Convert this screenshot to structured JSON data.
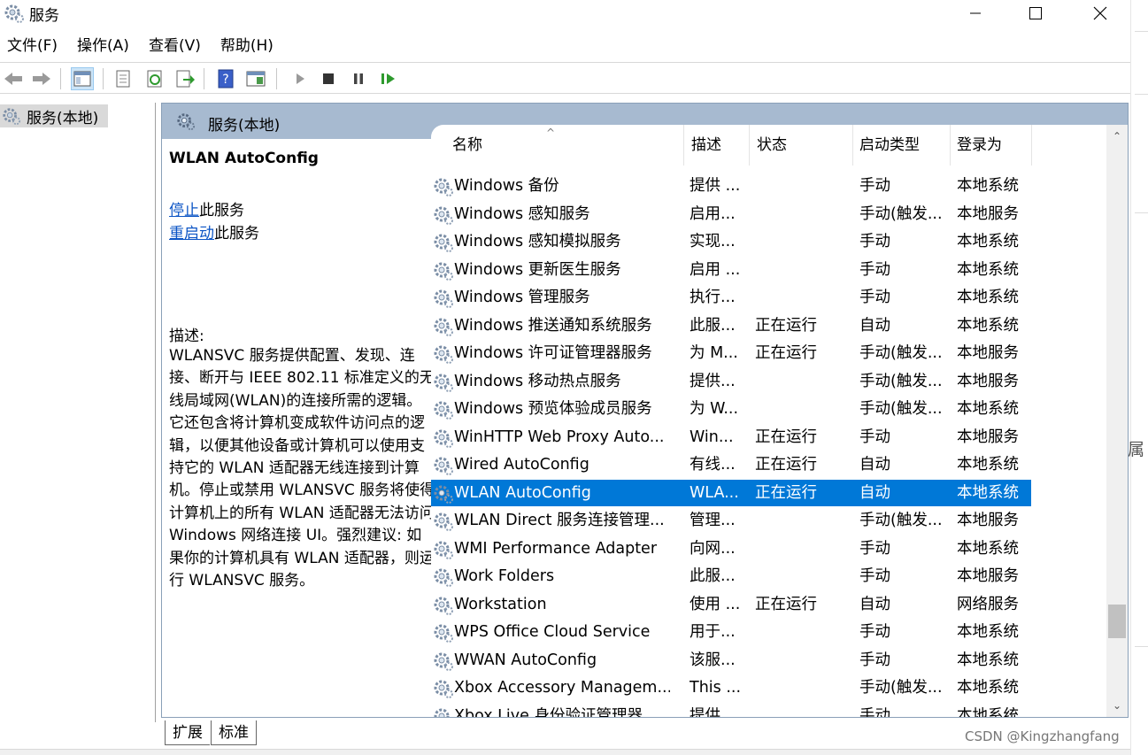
{
  "window": {
    "title": "服务",
    "minimize": "—",
    "maximize": "☐",
    "close": "✕"
  },
  "menu": [
    "文件(F)",
    "操作(A)",
    "查看(V)",
    "帮助(H)"
  ],
  "tree": {
    "item": "服务(本地)"
  },
  "panel": {
    "header": "服务(本地)"
  },
  "details": {
    "title": "WLAN AutoConfig",
    "stop_link": "停止",
    "stop_suffix": "此服务",
    "restart_link": "重启动",
    "restart_suffix": "此服务",
    "desc_label": "描述:",
    "desc_text": "WLANSVC 服务提供配置、发现、连接、断开与 IEEE 802.11 标准定义的无线局域网(WLAN)的连接所需的逻辑。它还包含将计算机变成软件访问点的逻辑，以便其他设备或计算机可以使用支持它的 WLAN 适配器无线连接到计算机。停止或禁用 WLANSVC 服务将使得计算机上的所有 WLAN 适配器无法访问 Windows 网络连接 UI。强烈建议: 如果你的计算机具有 WLAN 适配器，则运行 WLANSVC 服务。"
  },
  "columns": {
    "name": "名称",
    "desc": "描述",
    "status": "状态",
    "stype": "启动类型",
    "logon": "登录为",
    "sort_indicator": "^"
  },
  "rows": [
    {
      "name": "Windows 备份",
      "desc": "提供 ...",
      "status": "",
      "stype": "手动",
      "logon": "本地系统"
    },
    {
      "name": "Windows 感知服务",
      "desc": "启用...",
      "status": "",
      "stype": "手动(触发...",
      "logon": "本地服务"
    },
    {
      "name": "Windows 感知模拟服务",
      "desc": "实现...",
      "status": "",
      "stype": "手动",
      "logon": "本地系统"
    },
    {
      "name": "Windows 更新医生服务",
      "desc": "启用 ...",
      "status": "",
      "stype": "手动",
      "logon": "本地系统"
    },
    {
      "name": "Windows 管理服务",
      "desc": "执行...",
      "status": "",
      "stype": "手动",
      "logon": "本地系统"
    },
    {
      "name": "Windows 推送通知系统服务",
      "desc": "此服...",
      "status": "正在运行",
      "stype": "自动",
      "logon": "本地系统"
    },
    {
      "name": "Windows 许可证管理器服务",
      "desc": "为 M...",
      "status": "正在运行",
      "stype": "手动(触发...",
      "logon": "本地服务"
    },
    {
      "name": "Windows 移动热点服务",
      "desc": "提供...",
      "status": "",
      "stype": "手动(触发...",
      "logon": "本地服务"
    },
    {
      "name": "Windows 预览体验成员服务",
      "desc": "为 W...",
      "status": "",
      "stype": "手动(触发...",
      "logon": "本地系统"
    },
    {
      "name": "WinHTTP Web Proxy Auto...",
      "desc": "Win...",
      "status": "正在运行",
      "stype": "手动",
      "logon": "本地服务"
    },
    {
      "name": "Wired AutoConfig",
      "desc": "有线...",
      "status": "正在运行",
      "stype": "自动",
      "logon": "本地系统"
    },
    {
      "name": "WLAN AutoConfig",
      "desc": "WLA...",
      "status": "正在运行",
      "stype": "自动",
      "logon": "本地系统",
      "selected": true
    },
    {
      "name": "WLAN Direct 服务连接管理...",
      "desc": "管理...",
      "status": "",
      "stype": "手动(触发...",
      "logon": "本地服务"
    },
    {
      "name": "WMI Performance Adapter",
      "desc": "向网...",
      "status": "",
      "stype": "手动",
      "logon": "本地系统"
    },
    {
      "name": "Work Folders",
      "desc": "此服...",
      "status": "",
      "stype": "手动",
      "logon": "本地服务"
    },
    {
      "name": "Workstation",
      "desc": "使用 ...",
      "status": "正在运行",
      "stype": "自动",
      "logon": "网络服务"
    },
    {
      "name": "WPS Office Cloud Service",
      "desc": "用于...",
      "status": "",
      "stype": "手动",
      "logon": "本地系统"
    },
    {
      "name": "WWAN AutoConfig",
      "desc": "该服...",
      "status": "",
      "stype": "手动",
      "logon": "本地系统"
    },
    {
      "name": "Xbox Accessory Managem...",
      "desc": "This ...",
      "status": "",
      "stype": "手动(触发...",
      "logon": "本地系统"
    },
    {
      "name": "Xbox Live 身份验证管理器",
      "desc": "提供...",
      "status": "",
      "stype": "手动",
      "logon": "本地系统"
    }
  ],
  "tabs": [
    "扩展",
    "标准"
  ],
  "side_char": "属",
  "watermark": "CSDN @Kingzhangfang",
  "colors": {
    "selected": "#0078d7",
    "header": "#a7bad0",
    "link": "#0b54c5"
  }
}
